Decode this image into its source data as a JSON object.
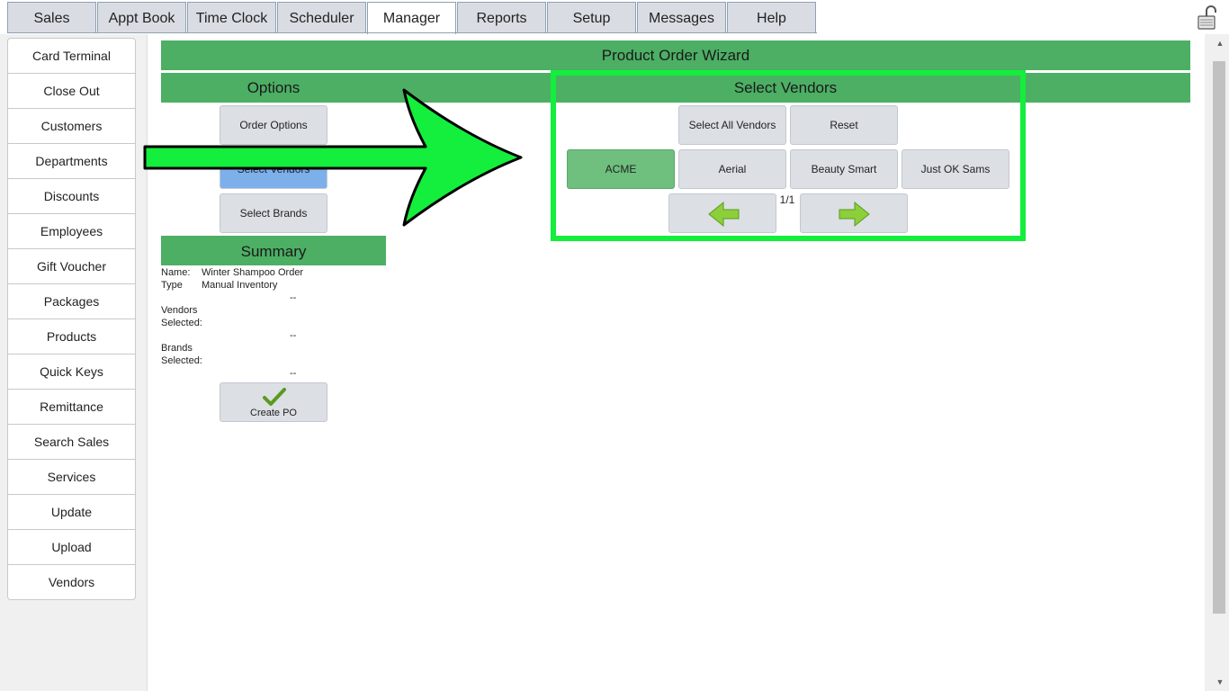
{
  "tabs": [
    {
      "label": "Sales",
      "active": false
    },
    {
      "label": "Appt Book",
      "active": false
    },
    {
      "label": "Time Clock",
      "active": false
    },
    {
      "label": "Scheduler",
      "active": false
    },
    {
      "label": "Manager",
      "active": true
    },
    {
      "label": "Reports",
      "active": false
    },
    {
      "label": "Setup",
      "active": false
    },
    {
      "label": "Messages",
      "active": false
    },
    {
      "label": "Help",
      "active": false
    }
  ],
  "sidebar": {
    "items": [
      {
        "label": "Card Terminal"
      },
      {
        "label": "Close Out"
      },
      {
        "label": "Customers"
      },
      {
        "label": "Departments"
      },
      {
        "label": "Discounts"
      },
      {
        "label": "Employees"
      },
      {
        "label": "Gift Voucher"
      },
      {
        "label": "Packages"
      },
      {
        "label": "Products"
      },
      {
        "label": "Quick Keys"
      },
      {
        "label": "Remittance"
      },
      {
        "label": "Search Sales"
      },
      {
        "label": "Services"
      },
      {
        "label": "Update"
      },
      {
        "label": "Upload"
      },
      {
        "label": "Vendors"
      }
    ]
  },
  "wizard": {
    "title": "Product Order Wizard",
    "options_header": "Options",
    "vendors_header": "Select Vendors",
    "option_buttons": {
      "order_options": "Order Options",
      "select_vendors": "Select Vendors",
      "select_brands": "Select Brands"
    },
    "vendor_controls": {
      "select_all": "Select All Vendors",
      "reset": "Reset"
    },
    "vendors": [
      {
        "name": "ACME",
        "selected": true
      },
      {
        "name": "Aerial",
        "selected": false
      },
      {
        "name": "Beauty Smart",
        "selected": false
      },
      {
        "name": "Just OK Sams",
        "selected": false
      }
    ],
    "page_indicator": "1/1"
  },
  "summary": {
    "header": "Summary",
    "name_label": "Name:",
    "name_value": "Winter Shampoo Order",
    "type_label": "Type",
    "type_value": "Manual Inventory",
    "dash": "--",
    "vendors_label_1": "Vendors",
    "vendors_label_2": "Selected:",
    "brands_label_1": "Brands",
    "brands_label_2": "Selected:",
    "create_po": "Create PO"
  },
  "colors": {
    "header_green": "#4caf64",
    "highlight_green": "#14ee3c",
    "selected_blue": "#7db0ea",
    "selected_vendor_green": "#6fbf7e"
  },
  "icons": [
    "lock-icon",
    "arrow-left-icon",
    "arrow-right-icon",
    "checkmark-icon",
    "annotation-arrow-icon"
  ]
}
